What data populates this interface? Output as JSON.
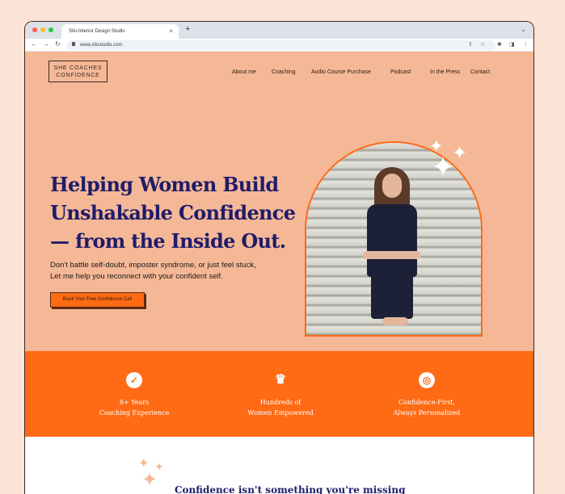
{
  "browser": {
    "tab_title": "Silo-Interior Design Studio",
    "tab_close": "×",
    "new_tab": "+",
    "tab_menu": "⌄",
    "url": "www.silostudio.com",
    "back": "←",
    "forward": "→",
    "reload": "↻",
    "share": "⇪",
    "star": "☆",
    "extensions": "✱",
    "sidepanel": "◨",
    "menu": "⋮"
  },
  "site": {
    "logo": {
      "line1": "SHE COACHES",
      "line2": "CONFIDENCE"
    },
    "nav": [
      "About me",
      "Coaching",
      "Audio Course Purchase",
      "Podcast",
      "In the Press",
      "Contact"
    ],
    "hero": {
      "headline": [
        "Helping Women Build",
        "Unshakable Confidence",
        "— from the Inside Out."
      ],
      "subtext": [
        "Don't battle self-doubt, imposter syndrome, or just feel stuck,",
        "Let me help you reconnect with your confident self."
      ],
      "cta": "Book Your Free Confidence Call"
    },
    "features": [
      {
        "icon": "check-circle-icon",
        "glyph": "✓",
        "line1": "8+ Years",
        "line2": "Coaching Experience"
      },
      {
        "icon": "crown-icon",
        "glyph": "♛",
        "line1": "Hundreds of",
        "line2": "Women Empowered"
      },
      {
        "icon": "target-icon",
        "glyph": "◎",
        "line1": "Confidence-First,",
        "line2": "Always Personalized"
      }
    ],
    "next_section_heading": "Confidence isn't something you're missing"
  },
  "colors": {
    "peach": "#f5b896",
    "orange": "#ff6a14",
    "navy": "#1f1c6a"
  }
}
